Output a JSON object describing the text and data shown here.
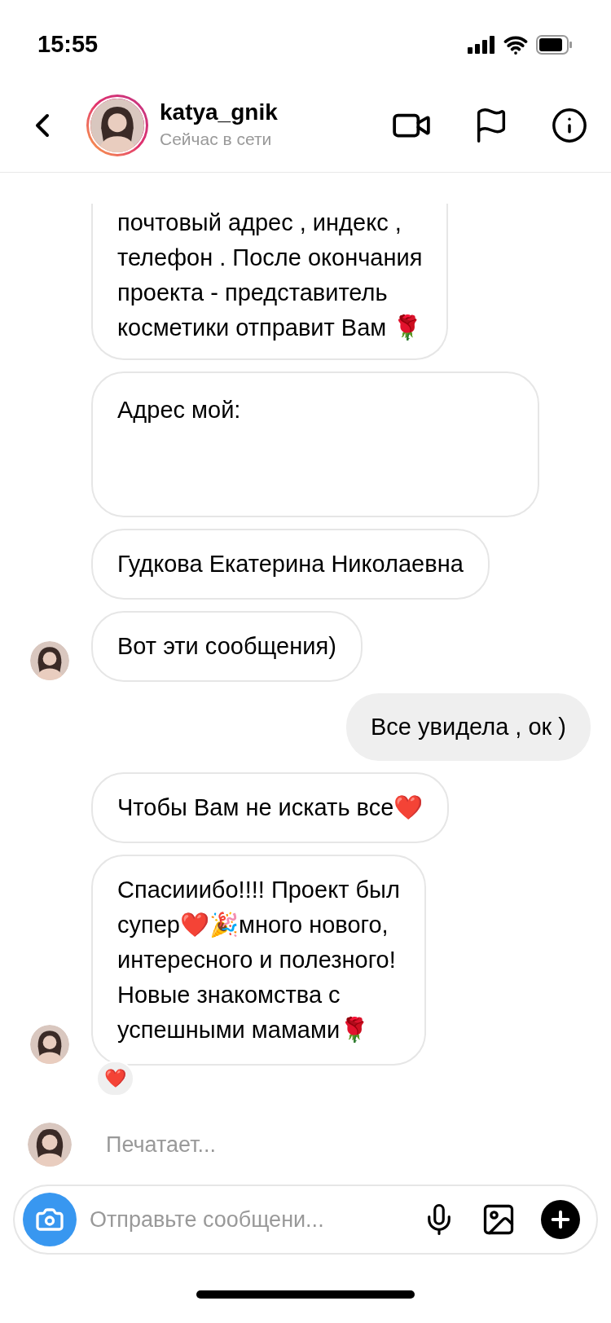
{
  "status_bar": {
    "time": "15:55"
  },
  "header": {
    "username": "katya_gnik",
    "status": "Сейчас в сети",
    "has_story": true
  },
  "messages": [
    {
      "kind": "incoming",
      "text": "почтовый адрес , индекс ,\nтелефон . После окончания\nпроекта - представитель\nкосметики отправит Вам 🌹",
      "avatar": false,
      "redacted": false,
      "cut_top": true
    },
    {
      "kind": "incoming",
      "text": "Адрес мой:",
      "avatar": false,
      "redacted": true,
      "cut_top": false
    },
    {
      "kind": "incoming",
      "text": "Гудкова Екатерина Николаевна",
      "avatar": false,
      "redacted": false,
      "cut_top": false
    },
    {
      "kind": "incoming",
      "text": "Вот эти сообщения)",
      "avatar": true,
      "redacted": false,
      "cut_top": false
    },
    {
      "kind": "outgoing",
      "text": "Все увидела , ок )",
      "avatar": false,
      "redacted": false,
      "cut_top": false
    },
    {
      "kind": "incoming",
      "text": "Чтобы Вам не искать все❤️",
      "avatar": false,
      "redacted": false,
      "cut_top": false
    },
    {
      "kind": "incoming",
      "text": "Спасииибо!!!! Проект был\nсупер❤️🎉много нового,\nинтересного и полезного!\nНовые знакомства с\nуспешными мамами🌹",
      "avatar": true,
      "redacted": false,
      "cut_top": false,
      "reaction": "❤️"
    }
  ],
  "typing": {
    "text": "Печатает..."
  },
  "composer": {
    "placeholder": "Отправьте сообщени..."
  }
}
